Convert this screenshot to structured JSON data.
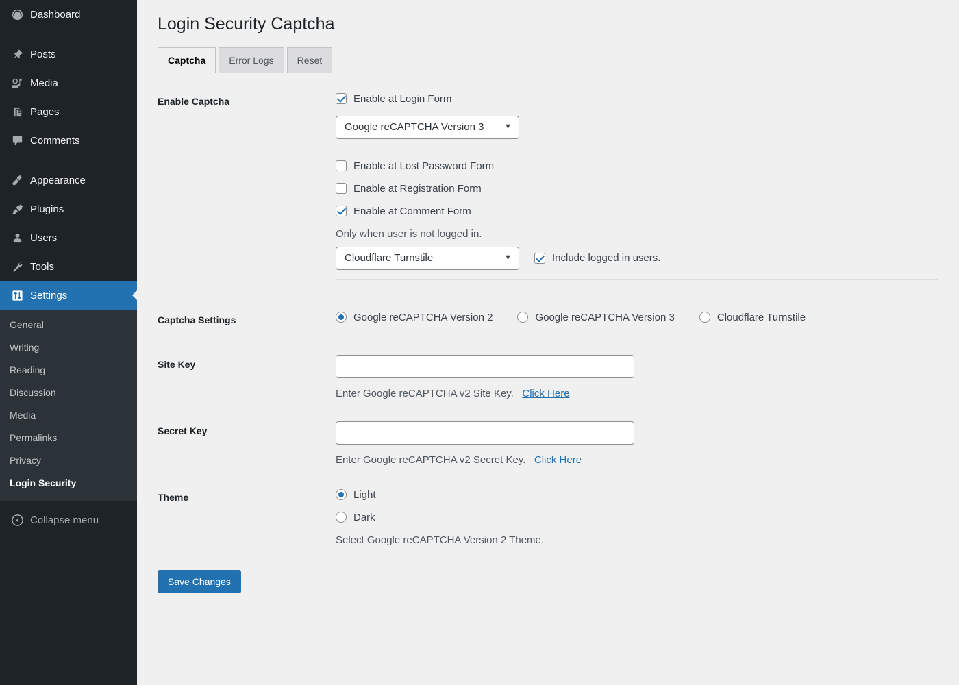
{
  "sidebar": {
    "items": [
      {
        "label": "Dashboard",
        "icon": "dashboard-icon",
        "gap": false
      },
      {
        "label": "Posts",
        "icon": "pin-icon",
        "gap": true
      },
      {
        "label": "Media",
        "icon": "media-icon",
        "gap": false
      },
      {
        "label": "Pages",
        "icon": "pages-icon",
        "gap": false
      },
      {
        "label": "Comments",
        "icon": "comments-icon",
        "gap": false
      },
      {
        "label": "Appearance",
        "icon": "appearance-icon",
        "gap": true
      },
      {
        "label": "Plugins",
        "icon": "plugins-icon",
        "gap": false
      },
      {
        "label": "Users",
        "icon": "users-icon",
        "gap": false
      },
      {
        "label": "Tools",
        "icon": "tools-icon",
        "gap": false
      },
      {
        "label": "Settings",
        "icon": "settings-icon",
        "gap": false
      }
    ],
    "active_item": "Settings",
    "submenu": [
      {
        "label": "General",
        "current": false
      },
      {
        "label": "Writing",
        "current": false
      },
      {
        "label": "Reading",
        "current": false
      },
      {
        "label": "Discussion",
        "current": false
      },
      {
        "label": "Media",
        "current": false
      },
      {
        "label": "Permalinks",
        "current": false
      },
      {
        "label": "Privacy",
        "current": false
      },
      {
        "label": "Login Security",
        "current": true
      }
    ],
    "collapse_label": "Collapse menu",
    "collapse_icon": "collapse-left-icon"
  },
  "header": {
    "title": "Login Security Captcha"
  },
  "tabs": [
    {
      "label": "Captcha",
      "active": true
    },
    {
      "label": "Error Logs",
      "active": false
    },
    {
      "label": "Reset",
      "active": false
    }
  ],
  "form": {
    "enable_captcha": {
      "label": "Enable Captcha",
      "login_form": {
        "label": "Enable at Login Form",
        "checked": true
      },
      "login_provider_select": {
        "value": "Google reCAPTCHA Version 3",
        "options": [
          "Google reCAPTCHA Version 2",
          "Google reCAPTCHA Version 3",
          "Cloudflare Turnstile"
        ]
      },
      "lost_password_form": {
        "label": "Enable at Lost Password Form",
        "checked": false
      },
      "registration_form": {
        "label": "Enable at Registration Form",
        "checked": false
      },
      "comment_form": {
        "label": "Enable at Comment Form",
        "checked": true
      },
      "comment_note": "Only when user is not logged in.",
      "comment_provider_select": {
        "value": "Cloudflare Turnstile",
        "options": [
          "Google reCAPTCHA Version 2",
          "Google reCAPTCHA Version 3",
          "Cloudflare Turnstile"
        ]
      },
      "include_logged_in": {
        "label": "Include logged in users.",
        "checked": true
      }
    },
    "captcha_settings": {
      "label": "Captcha Settings",
      "options": [
        {
          "label": "Google reCAPTCHA Version 2",
          "selected": true
        },
        {
          "label": "Google reCAPTCHA Version 3",
          "selected": false
        },
        {
          "label": "Cloudflare Turnstile",
          "selected": false
        }
      ]
    },
    "site_key": {
      "label": "Site Key",
      "value": "",
      "placeholder": "",
      "help_prefix": "Enter Google reCAPTCHA v2 Site Key.",
      "help_link": "Click Here"
    },
    "secret_key": {
      "label": "Secret Key",
      "value": "",
      "placeholder": "",
      "help_prefix": "Enter Google reCAPTCHA v2 Secret Key.",
      "help_link": "Click Here"
    },
    "theme": {
      "label": "Theme",
      "options": [
        {
          "label": "Light",
          "selected": true
        },
        {
          "label": "Dark",
          "selected": false
        }
      ],
      "help": "Select Google reCAPTCHA Version 2 Theme."
    },
    "save_label": "Save Changes"
  },
  "colors": {
    "sidebar_bg": "#1d2327",
    "submenu_bg": "#2c3338",
    "accent": "#2271b1",
    "page_bg": "#f0f0f1",
    "link": "#2271b1"
  }
}
